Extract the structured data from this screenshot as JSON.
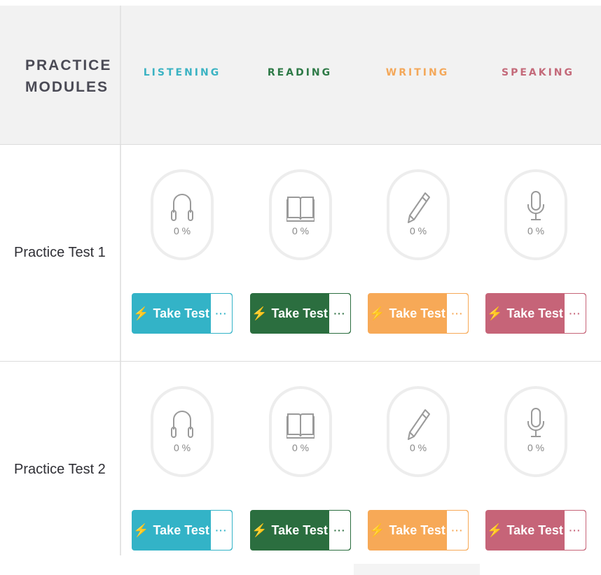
{
  "header": {
    "module_title": "PRACTICE MODULES",
    "columns": [
      {
        "label": "LISTENING",
        "color": "#3bb3c3"
      },
      {
        "label": "READING",
        "color": "#2e7a47"
      },
      {
        "label": "WRITING",
        "color": "#f4a85a"
      },
      {
        "label": "SPEAKING",
        "color": "#c46a7a"
      }
    ]
  },
  "rows": [
    {
      "label": "Practice Test 1",
      "cells": [
        {
          "icon": "headphones-icon",
          "progress": "0 %",
          "button": "Take Test",
          "more": "···"
        },
        {
          "icon": "book-icon",
          "progress": "0 %",
          "button": "Take Test",
          "more": "···"
        },
        {
          "icon": "pencil-icon",
          "progress": "0 %",
          "button": "Take Test",
          "more": "···"
        },
        {
          "icon": "microphone-icon",
          "progress": "0 %",
          "button": "Take Test",
          "more": "···"
        }
      ]
    },
    {
      "label": "Practice Test 2",
      "cells": [
        {
          "icon": "headphones-icon",
          "progress": "0 %",
          "button": "Take Test",
          "more": "···"
        },
        {
          "icon": "book-icon",
          "progress": "0 %",
          "button": "Take Test",
          "more": "···"
        },
        {
          "icon": "pencil-icon",
          "progress": "0 %",
          "button": "Take Test",
          "more": "···"
        },
        {
          "icon": "microphone-icon",
          "progress": "0 %",
          "button": "Take Test",
          "more": "···"
        }
      ]
    }
  ],
  "button_colors": [
    "#33b3c7",
    "#2b6e3f",
    "#f7a957",
    "#c66478"
  ]
}
